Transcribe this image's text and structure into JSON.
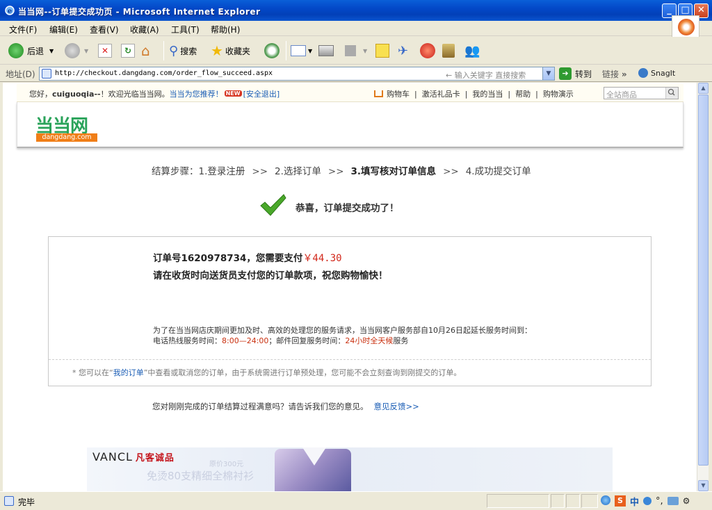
{
  "window": {
    "title": "当当网--订单提交成功页 - Microsoft Internet Explorer",
    "min_glyph": "_",
    "max_glyph": "□",
    "close_glyph": "✕"
  },
  "menu": [
    "文件(F)",
    "编辑(E)",
    "查看(V)",
    "收藏(A)",
    "工具(T)",
    "帮助(H)"
  ],
  "toolbar": {
    "back": "后退",
    "search": "搜索",
    "favorites": "收藏夹"
  },
  "address": {
    "label": "地址(D)",
    "url": "http://checkout.dangdang.com/order_flow_succeed.aspx",
    "search_hint": "输入关键字 直接搜索",
    "go": "转到",
    "links": "链接",
    "snagit": "SnagIt"
  },
  "page": {
    "greeting_prefix": "您好，",
    "user": "cuiguoqia--",
    "greeting_suffix": "！欢迎光临当当网。",
    "recommend": "当当为您推荐！",
    "new_tag": "NEW",
    "logout": "[安全退出]",
    "nav_links": [
      "购物车",
      "激活礼品卡",
      "我的当当",
      "帮助",
      "购物演示"
    ],
    "search_placeholder": "全站商品",
    "logo_cn": "当当网",
    "logo_en": "dangdang.com",
    "steps": {
      "label": "结算步骤：",
      "step1": "1.登录注册",
      "step2": "2.选择订单",
      "step3": "3.填写核对订单信息",
      "step4": "4.成功提交订单",
      "sep": ">>"
    },
    "success_msg": "恭喜，订单提交成功了！",
    "order": {
      "prefix": "订单号1620978734，您需要支付",
      "amount": "￥44.30",
      "pay_note": "请在收货时向送货员支付您的订单款项，祝您购物愉快！",
      "notice1": "为了在当当网店庆期间更加及时、高效的处理您的服务请求，当当网客户服务部自10月26日起延长服务时间到：",
      "hotline_label": "电话热线服务时间：",
      "hotline_time": "8:00—24:00",
      "mail_label": "；邮件回复服务时间：",
      "mail_time": "24小时全天候",
      "mail_suffix": "服务",
      "foot_prefix": "* 您可以在“",
      "foot_link": "我的订单",
      "foot_suffix": "”中查看或取消您的订单，由于系统需进行订单预处理，您可能不会立刻查询到刚提交的订单。"
    },
    "feedback_q": "您对刚刚完成的订单结算过程满意吗？请告诉我们您的意见。",
    "feedback_link": "意见反馈>>",
    "banner": {
      "brand": "VANCL",
      "brand_cn": "凡客诚品",
      "price": "原价300元",
      "slogan": "免烫80支精细全棉衬衫"
    }
  },
  "status": {
    "text": "完毕",
    "ime_s": "S",
    "ime_zh": "中"
  }
}
